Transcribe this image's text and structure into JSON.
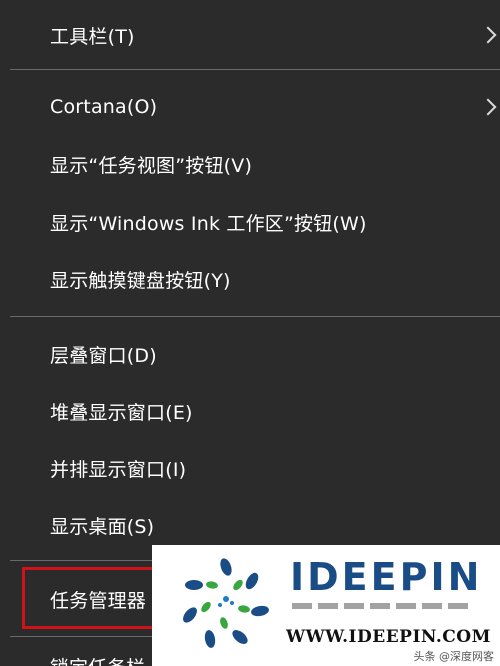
{
  "menu": {
    "items": [
      {
        "label": "工具栏(T)",
        "submenu": true
      },
      {
        "label": "Cortana(O)",
        "submenu": true
      },
      {
        "label": "显示“任务视图”按钮(V)",
        "submenu": false
      },
      {
        "label": "显示“Windows Ink 工作区”按钮(W)",
        "submenu": false
      },
      {
        "label": "显示触摸键盘按钮(Y)",
        "submenu": false
      },
      {
        "label": "层叠窗口(D)",
        "submenu": false
      },
      {
        "label": "堆叠显示窗口(E)",
        "submenu": false
      },
      {
        "label": "并排显示窗口(I)",
        "submenu": false
      },
      {
        "label": "显示桌面(S)",
        "submenu": false
      },
      {
        "label": "任务管理器",
        "submenu": false
      }
    ],
    "cut_label": "锁定任务栏",
    "highlight_color": "#d0121b"
  },
  "watermark": {
    "brand": "IDEEPIN",
    "url": "WWW.IDEEPIN.COM",
    "source": "头条 @深度网客"
  },
  "colors": {
    "menu_bg": "#2b2b2b",
    "text": "#ffffff",
    "separator": "#6a6a6a",
    "brand_blue": "#1a4d86",
    "logo_green": "#3aa63f"
  }
}
